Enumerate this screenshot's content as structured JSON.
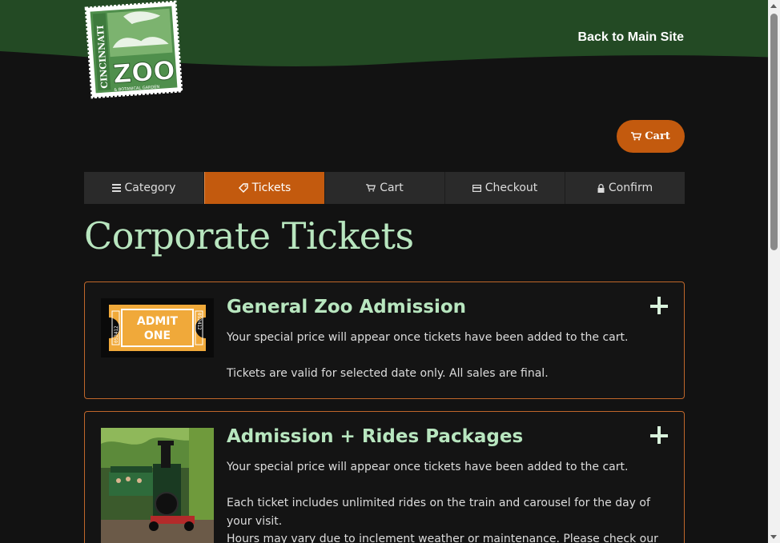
{
  "header": {
    "logo_alt": "Cincinnati Zoo & Botanical Garden",
    "logo_text_top": "CINCINNATI",
    "logo_text_main": "ZOO",
    "logo_text_sub": "& BOTANICAL GARDEN",
    "back_link": "Back to Main Site",
    "bg_color": "#234a24"
  },
  "cart_button": {
    "icon": "cart-icon",
    "label": "Cart"
  },
  "steps": [
    {
      "icon": "menu-icon",
      "label": "Category",
      "active": false
    },
    {
      "icon": "tag-icon",
      "label": "Tickets",
      "active": true
    },
    {
      "icon": "cart-icon",
      "label": "Cart",
      "active": false
    },
    {
      "icon": "credit-card-icon",
      "label": "Checkout",
      "active": false
    },
    {
      "icon": "lock-icon",
      "label": "Confirm",
      "active": false
    }
  ],
  "page_title": "Corporate Tickets",
  "products": [
    {
      "title": "General Zoo Admission",
      "image_text": "ADMIT ONE",
      "image_number": "052412",
      "lines": [
        "Your special price will appear once tickets have been added to the cart.",
        "Tickets are valid for selected date only. All sales are final."
      ]
    },
    {
      "title": "Admission + Rides Packages",
      "image_alt": "Zoo train",
      "lines": [
        "Your special price will appear once tickets have been added to the cart.",
        "Each ticket includes unlimited rides on the train and carousel for the day of your visit.",
        "Hours may vary due to inclement weather or maintenance. Please check our"
      ]
    }
  ],
  "colors": {
    "accent": "#c35a0e",
    "title_green": "#b8e6bf",
    "background": "#121212",
    "card_border": "#c0672a"
  }
}
